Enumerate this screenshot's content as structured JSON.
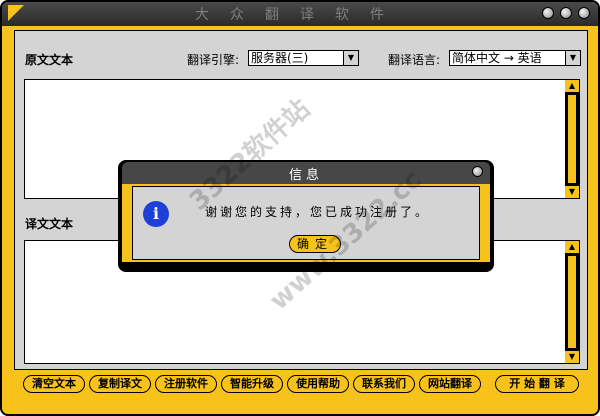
{
  "window": {
    "title": "大众翻译软件"
  },
  "labels": {
    "source": "原文文本",
    "engine": "翻译引擎:",
    "language": "翻译语言:",
    "target": "译文文本"
  },
  "engine": {
    "selected": "服务器(三)"
  },
  "language": {
    "selected": "简体中文 → 英语"
  },
  "buttons": {
    "clear": "清空文本",
    "copy": "复制译文",
    "register": "注册软件",
    "upgrade": "智能升级",
    "help": "使用帮助",
    "contact": "联系我们",
    "web": "网站翻译",
    "start": "开 始 翻 译"
  },
  "dialog": {
    "title": "信息",
    "message": "谢谢您的支持，您已成功注册了。",
    "ok": "确定"
  },
  "watermark": {
    "line1": "3322软件站",
    "line2": "www.3322.cc"
  },
  "colors": {
    "accent": "#f6c21b",
    "frame": "#000000",
    "panel": "#d4d4d4",
    "info": "#1e3fd8"
  },
  "icons": [
    "info-icon",
    "chevron-down-icon",
    "scroll-up-icon",
    "scroll-down-icon"
  ]
}
